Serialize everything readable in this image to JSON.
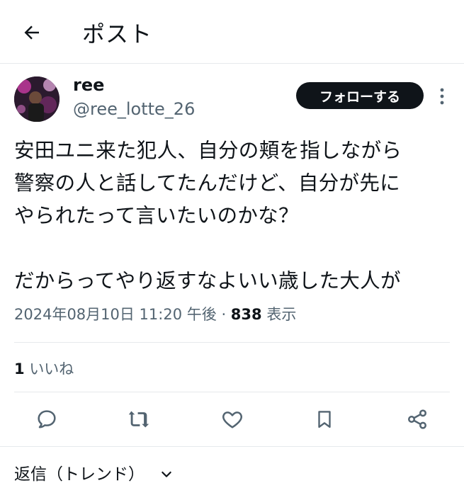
{
  "header": {
    "title": "ポスト",
    "back_icon": "arrow-left-icon"
  },
  "author": {
    "display_name": "ree",
    "handle": "@ree_lotte_26",
    "avatar_colors": [
      "#2b1a2e",
      "#c03a9b",
      "#f1b3e8"
    ]
  },
  "actions_top": {
    "follow_label": "フォローする",
    "more_icon": "more-vertical-icon"
  },
  "post": {
    "text": "安田ユニ来た犯人、自分の頬を指しながら\n警察の人と話してたんだけど、自分が先に\nやられたって言いたいのかな？\n\nだからってやり返すなよいい歳した大人が",
    "timestamp": "2024年08月10日 11:20 午後",
    "separator": " · ",
    "views_count": "838",
    "views_label": "表示"
  },
  "stats": {
    "likes_count": "1",
    "likes_label": "いいね"
  },
  "action_bar": {
    "icons": [
      "reply-icon",
      "repost-icon",
      "like-icon",
      "bookmark-icon",
      "share-icon"
    ],
    "icon_color": "#536471"
  },
  "replies": {
    "sort_label": "返信（トレンド）",
    "chevron_icon": "chevron-down-icon"
  }
}
